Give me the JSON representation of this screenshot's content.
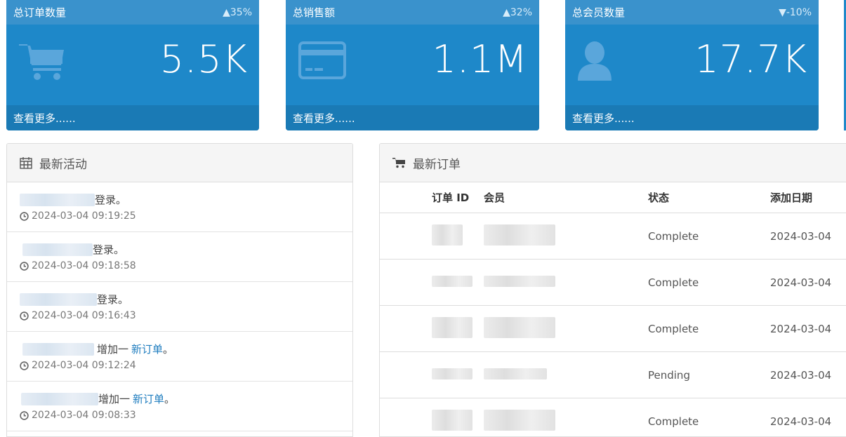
{
  "tiles": [
    {
      "title": "总订单数量",
      "change": "▲35%",
      "value": "5.5K",
      "more": "查看更多......",
      "icon": "shopping-cart-icon"
    },
    {
      "title": "总销售额",
      "change": "▲32%",
      "value": "1.1M",
      "more": "查看更多......",
      "icon": "credit-card-icon"
    },
    {
      "title": "总会员数量",
      "change": "▼-10%",
      "value": "17.7K",
      "more": "查看更多......",
      "icon": "user-icon"
    }
  ],
  "activity": {
    "title": "最新活动",
    "icon": "calendar-icon",
    "items": [
      {
        "text": "登录。",
        "link": "",
        "time": "2024-03-04 09:19:25"
      },
      {
        "text": "登录。",
        "link": "",
        "time": "2024-03-04 09:18:58"
      },
      {
        "text": "登录。",
        "link": "",
        "time": "2024-03-04 09:16:43"
      },
      {
        "text": "增加一",
        "link": "新订单",
        "suffix": "。",
        "time": "2024-03-04 09:12:24"
      },
      {
        "text": "增加一",
        "link": "新订单",
        "suffix": "。",
        "time": "2024-03-04 09:08:33"
      }
    ]
  },
  "orders": {
    "title": "最新订单",
    "icon": "cart-icon",
    "columns": [
      "订单 ID",
      "会员",
      "状态",
      "添加日期"
    ],
    "rows": [
      {
        "status": "Complete",
        "date": "2024-03-04"
      },
      {
        "status": "Complete",
        "date": "2024-03-04"
      },
      {
        "status": "Complete",
        "date": "2024-03-04"
      },
      {
        "status": "Pending",
        "date": "2024-03-04"
      },
      {
        "status": "Complete",
        "date": "2024-03-04"
      }
    ]
  },
  "colors": {
    "tile": "#1e88c9",
    "tile_head": "#3a92cc",
    "tile_foot": "#1a7ab5",
    "link": "#1f7dbf"
  }
}
